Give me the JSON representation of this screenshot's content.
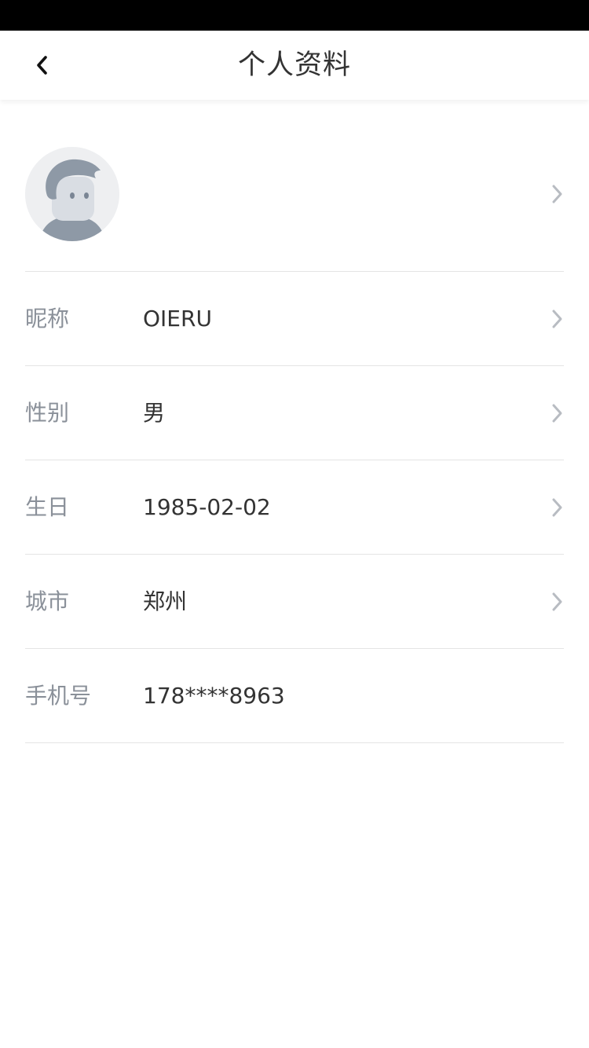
{
  "header": {
    "title": "个人资料",
    "back_icon": "chevron-left-icon"
  },
  "avatar": {
    "icon": "default-user-avatar",
    "colors": {
      "background": "#eeeff1",
      "figure": "#8e99a6",
      "face": "#d9dde3"
    }
  },
  "rows": [
    {
      "label": "昵称",
      "value": "OIERU",
      "has_chevron": true
    },
    {
      "label": "性别",
      "value": "男",
      "has_chevron": true
    },
    {
      "label": "生日",
      "value": "1985-02-02",
      "has_chevron": true
    },
    {
      "label": "城市",
      "value": "郑州",
      "has_chevron": true
    },
    {
      "label": "手机号",
      "value": "178****8963",
      "has_chevron": false
    }
  ],
  "colors": {
    "status_bar": "#000000",
    "title_text": "#333333",
    "label_text": "#8a9099",
    "value_text": "#333333",
    "divider": "#e4e4e4",
    "chevron": "#b8bcc2"
  }
}
